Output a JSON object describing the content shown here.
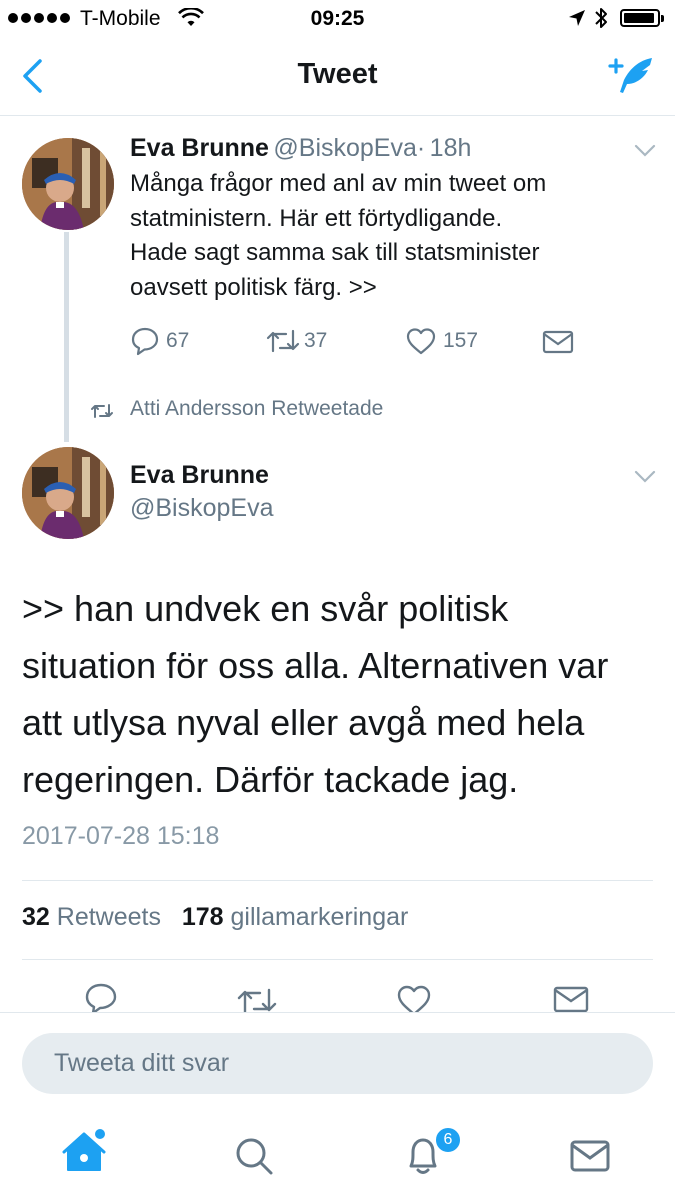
{
  "status_bar": {
    "carrier": "T-Mobile",
    "time": "09:25",
    "battery_level": 0.95
  },
  "nav": {
    "title": "Tweet"
  },
  "tweet_quoted": {
    "name": "Eva Brunne",
    "handle": "@BiskopEva",
    "separator": "·",
    "age": "18h",
    "text_lines": [
      "Många frågor med anl av min tweet om",
      "statministern. Här ett förtydligande.",
      "Hade sagt samma sak till statsminister",
      "oavsett politisk färg. >>"
    ],
    "reply_count": "67",
    "retweet_count": "37",
    "like_count": "157"
  },
  "retweet_notice": {
    "label": "Atti Andersson Retweetade"
  },
  "tweet_main": {
    "name": "Eva Brunne",
    "handle": "@BiskopEva",
    "text_lines": [
      ">> han undvek en svår politisk",
      "situation för oss alla. Alternativen var",
      "att utlysa nyval eller avgå med hela",
      "regeringen. Därför tackade jag."
    ],
    "timestamp": "2017-07-28 15:18",
    "retweets_count": "32",
    "retweets_label": "Retweets",
    "likes_count": "178",
    "likes_label": "gillamarkeringar"
  },
  "reply_box": {
    "placeholder": "Tweeta ditt svar"
  },
  "tab_bar": {
    "notifications_badge": "6"
  },
  "colors": {
    "accent": "#1da1f2",
    "text": "#14171a",
    "secondary": "#657786",
    "divider": "#e1e8ed"
  }
}
